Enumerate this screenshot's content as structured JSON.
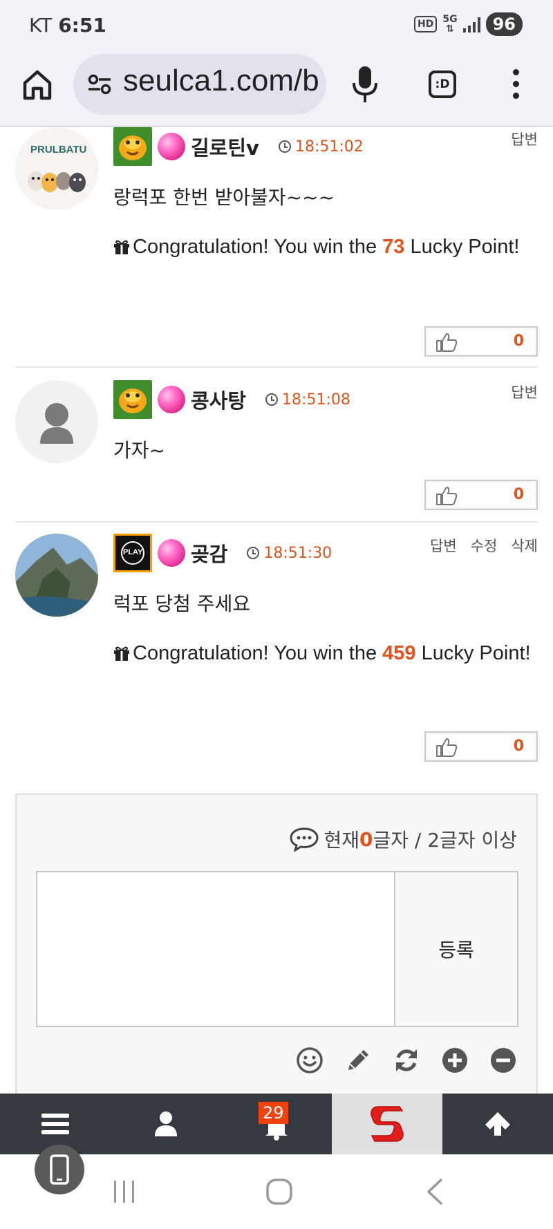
{
  "status_bar": {
    "carrier": "KT",
    "time": "6:51",
    "hd_label": "HD",
    "network_label": "5G",
    "battery": "96"
  },
  "browser": {
    "url": "seulca1.com/b",
    "tab_switcher_label": ":D"
  },
  "comments": [
    {
      "nickname": "길로틴v",
      "time": "18:51:02",
      "actions": [
        "답변"
      ],
      "text": "랑럭포 한번 받아불자~~~",
      "lucky": {
        "prefix": "Congratulation! You win the ",
        "points": "73",
        "suffix": " Lucky Point!"
      },
      "likes": "0",
      "avatar_label": "PRULBATU"
    },
    {
      "nickname": "콩사탕",
      "time": "18:51:08",
      "actions": [
        "답변"
      ],
      "text": "가자~",
      "likes": "0"
    },
    {
      "nickname": "곶감",
      "time": "18:51:30",
      "actions": [
        "답변",
        "수정",
        "삭제"
      ],
      "text": "럭포 당첨 주세요",
      "lucky": {
        "prefix": "Congratulation! You win the ",
        "points": "459",
        "suffix": " Lucky Point!"
      },
      "likes": "0",
      "level_icon_label": "PLAY"
    }
  ],
  "form": {
    "counter_prefix": "현재 ",
    "count": "0",
    "counter_suffix": "글자 / 2글자 이상",
    "submit_label": "등록",
    "tools": [
      "smile-icon",
      "pencil-icon",
      "refresh-icon",
      "plus-circle-icon",
      "minus-circle-icon"
    ]
  },
  "bottom_nav": {
    "items": [
      "menu-icon",
      "user-icon",
      "bell-icon",
      "site-logo",
      "arrow-up-icon"
    ],
    "notification_count": "29"
  },
  "colors": {
    "accent": "#e0531c",
    "nav_bg": "#343a40",
    "badge": "#f0420f"
  }
}
